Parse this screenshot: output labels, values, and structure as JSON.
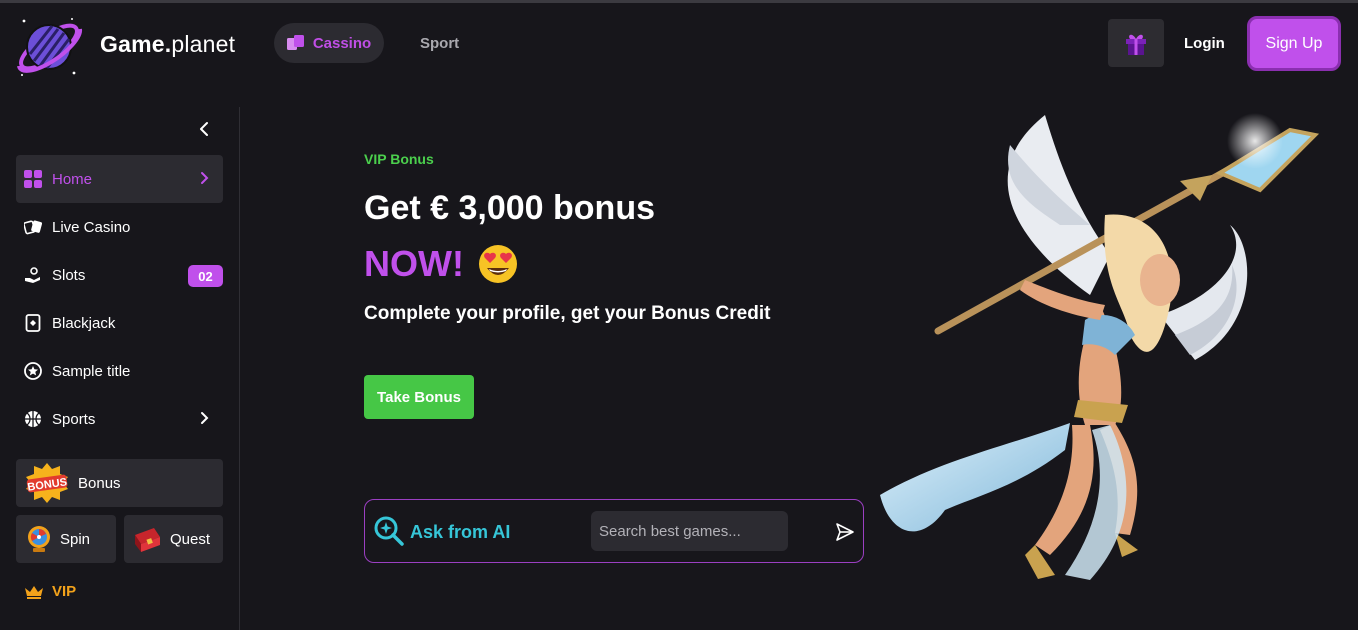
{
  "header": {
    "brand_bold": "Game.",
    "brand_light": "planet",
    "nav": [
      {
        "label": "Cassino",
        "active": true
      },
      {
        "label": "Sport",
        "active": false
      }
    ],
    "login_label": "Login",
    "signup_label": "Sign Up"
  },
  "sidebar": {
    "items": [
      {
        "label": "Home",
        "icon": "grid-icon",
        "active": true
      },
      {
        "label": "Live Casino",
        "icon": "cards-icon"
      },
      {
        "label": "Slots",
        "icon": "slots-hand-icon",
        "badge": "02"
      },
      {
        "label": "Blackjack",
        "icon": "card-icon"
      },
      {
        "label": "Sample title",
        "icon": "star-circle-icon"
      },
      {
        "label": "Sports",
        "icon": "basketball-icon"
      }
    ],
    "tiles": {
      "bonus": {
        "label": "Bonus",
        "icon_text": "BONUS"
      },
      "spin": {
        "label": "Spin"
      },
      "quest": {
        "label": "Quest"
      }
    },
    "vip_label": "VIP"
  },
  "hero": {
    "eyebrow": "VIP Bonus",
    "title": "Get € 3,000 bonus",
    "highlight": "NOW!",
    "emoji": "😍",
    "subtitle": "Complete your profile, get your Bonus Credit",
    "cta_label": "Take Bonus"
  },
  "ai_search": {
    "label": "Ask from AI",
    "placeholder": "Search best games..."
  },
  "colors": {
    "background": "#17161b",
    "accent": "#c050eb",
    "green": "#46c746",
    "cyan": "#36c6d8",
    "vip": "#f2a21b",
    "panel": "#2c2b31"
  }
}
